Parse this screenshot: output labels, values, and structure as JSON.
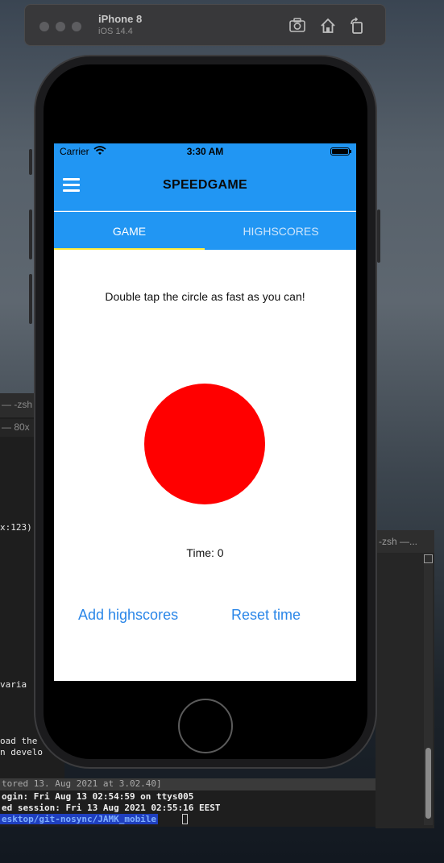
{
  "simulator": {
    "device_name": "iPhone 8",
    "os_version": "iOS 14.4",
    "icons": [
      "screenshot-icon",
      "home-icon",
      "rotate-icon"
    ]
  },
  "background_terminal": {
    "left_title": "— -zsh",
    "left_subtitle": "— 80x",
    "left_lines": [
      "x:123)",
      "varia"
    ],
    "bottom_left_lines": [
      "oad the",
      "n develo"
    ],
    "restored_text": "tored 13. Aug 2021 at 3.02.40]",
    "login_line": "ogin: Fri Aug 13 02:54:59 on ttys005",
    "session_line": "ed session: Fri 13 Aug 2021 02:55:16 EEST",
    "prompt_path": "esktop/git-nosync/JAMK_mobile",
    "right_title": "-zsh —..."
  },
  "status_bar": {
    "carrier": "Carrier",
    "time": "3:30 AM"
  },
  "header": {
    "title": "SPEEDGAME",
    "menu_icon": "hamburger-menu-icon"
  },
  "tabs": [
    {
      "label": "GAME",
      "active": true
    },
    {
      "label": "HIGHSCORES",
      "active": false
    }
  ],
  "game": {
    "instructions": "Double tap the circle as fast as you can!",
    "circle_color": "#ff0000",
    "time_label": "Time: 0"
  },
  "actions": {
    "add_highscores": "Add highscores",
    "reset_time": "Reset time"
  },
  "colors": {
    "primary": "#2196f3",
    "tab_indicator": "#ffeb3b",
    "link": "#2a86e8"
  }
}
